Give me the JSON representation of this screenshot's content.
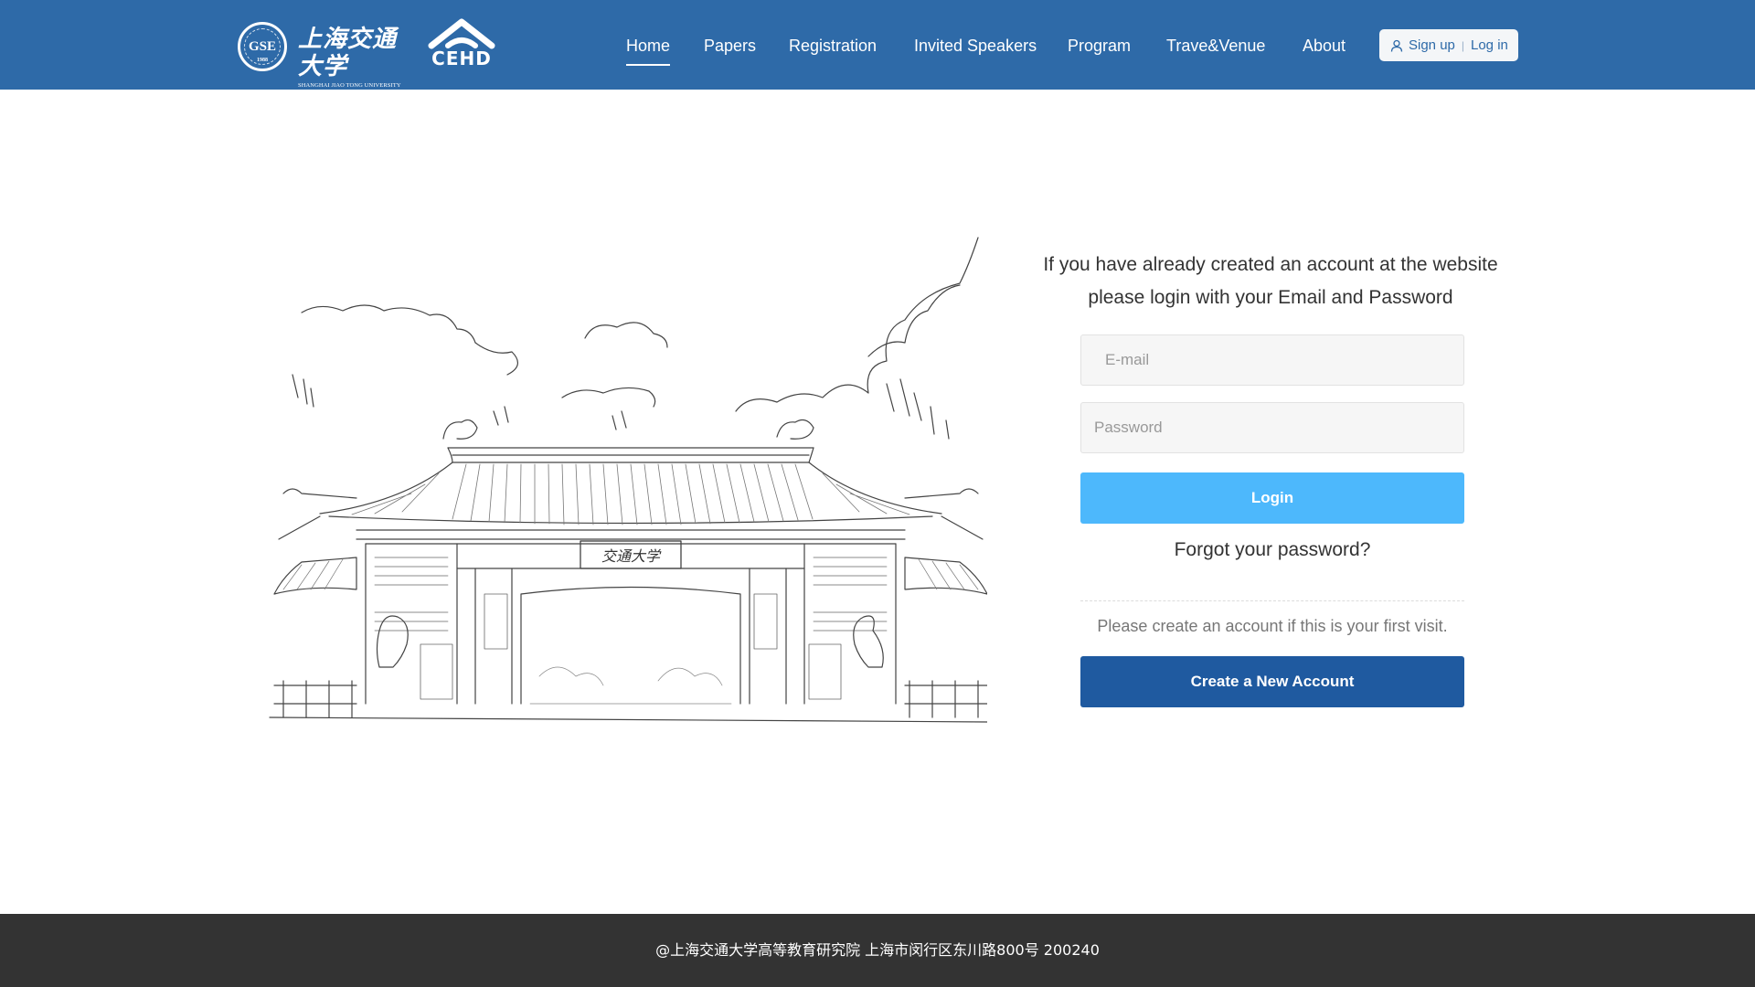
{
  "header": {
    "logos": {
      "gse": "GSE",
      "gse_year": "1988",
      "university_cn": "上海交通大学",
      "university_en": "SHANGHAI JIAO TONG UNIVERSITY",
      "cehd": "CEHD"
    },
    "nav": [
      {
        "label": "Home",
        "active": true
      },
      {
        "label": "Papers"
      },
      {
        "label": "Registration"
      },
      {
        "label": "Invited Speakers"
      },
      {
        "label": "Program"
      },
      {
        "label": "Trave&Venue"
      },
      {
        "label": "About"
      }
    ],
    "auth": {
      "signup": "Sign up",
      "separator": "|",
      "login": "Log in"
    },
    "colors": {
      "bar": "#2e6aa8",
      "text": "#ffffff"
    }
  },
  "illustration": {
    "plaque_text": "交通大学",
    "icon": "sjtu-gate-sketch"
  },
  "login": {
    "intro_line1": "If you have already created an account at the website",
    "intro_line2": "please login with your Email and Password",
    "email_placeholder": "E-mail",
    "password_placeholder": "Password",
    "login_button": "Login",
    "forgot": "Forgot your password?",
    "first_visit": "Please create an account if this is your first visit.",
    "create_button": "Create a New Account",
    "colors": {
      "login_button": "#4db8fc",
      "create_button": "#1f5aa0"
    }
  },
  "footer": {
    "text": "@上海交通大学高等教育研究院   上海市闵行区东川路800号   200240",
    "color": "#333333"
  }
}
